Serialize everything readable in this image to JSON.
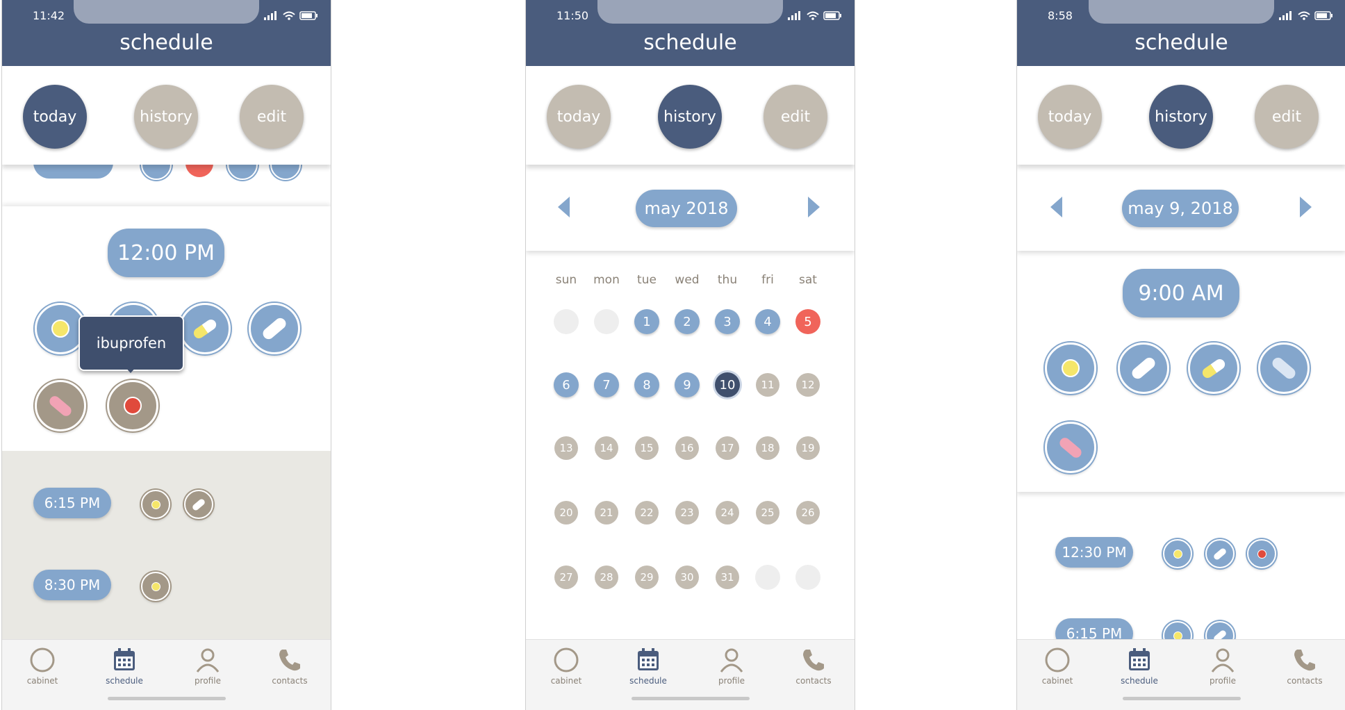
{
  "colors": {
    "header": "#4a5c7d",
    "accent": "#84a6cc",
    "taken": "#a39888",
    "missed": "#f0645a",
    "inactive": "#c3bcb1"
  },
  "screen1": {
    "status_time": "11:42",
    "title": "schedule",
    "tabs": {
      "today": "today",
      "history": "history",
      "edit": "edit"
    },
    "active_tab": "today",
    "current_time": "12:00 PM",
    "tooltip": "ibuprofen",
    "later": [
      {
        "time": "6:15 PM"
      },
      {
        "time": "8:30 PM"
      }
    ]
  },
  "screen2": {
    "status_time": "11:50",
    "title": "schedule",
    "tabs": {
      "today": "today",
      "history": "history",
      "edit": "edit"
    },
    "active_tab": "history",
    "month": "may 2018",
    "weekdays": [
      "sun",
      "mon",
      "tue",
      "wed",
      "thu",
      "fri",
      "sat"
    ],
    "days": [
      "1",
      "2",
      "3",
      "4",
      "5",
      "6",
      "7",
      "8",
      "9",
      "10",
      "11",
      "12",
      "13",
      "14",
      "15",
      "16",
      "17",
      "18",
      "19",
      "20",
      "21",
      "22",
      "23",
      "24",
      "25",
      "26",
      "27",
      "28",
      "29",
      "30",
      "31"
    ]
  },
  "screen3": {
    "status_time": "8:58",
    "title": "schedule",
    "tabs": {
      "today": "today",
      "history": "history",
      "edit": "edit"
    },
    "active_tab": "history",
    "date": "may 9, 2018",
    "current_time": "9:00 AM",
    "later": [
      {
        "time": "12:30 PM"
      },
      {
        "time": "6:15 PM"
      }
    ]
  },
  "nav": {
    "cabinet": "cabinet",
    "schedule": "schedule",
    "profile": "profile",
    "contacts": "contacts"
  },
  "icons": [
    "circle-icon",
    "calendar-icon",
    "person-icon",
    "phone-icon",
    "signal-icon",
    "wifi-icon",
    "battery-icon",
    "chevron-left-icon",
    "chevron-right-icon"
  ]
}
